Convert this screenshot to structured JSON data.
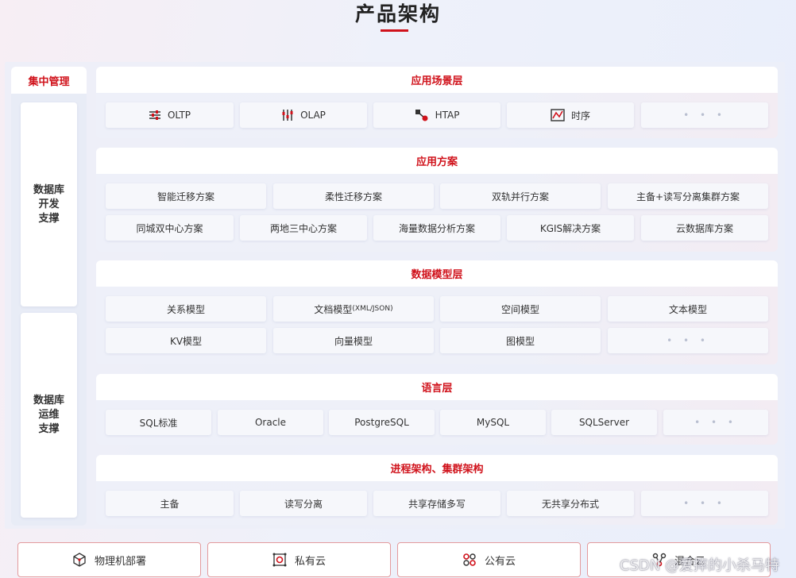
{
  "page": {
    "title": "产品架构",
    "accent_color": "#d0121b"
  },
  "left": {
    "header": "集中管理",
    "blocks": [
      [
        "数据库",
        "开发",
        "支撑"
      ],
      [
        "数据库",
        "运维",
        "支撑"
      ]
    ]
  },
  "sections": {
    "scenario": {
      "title": "应用场景层",
      "items": [
        {
          "label": "OLTP",
          "icon": "sliders-icon"
        },
        {
          "label": "OLAP",
          "icon": "equalizer-icon"
        },
        {
          "label": "HTAP",
          "icon": "hybrid-icon"
        },
        {
          "label": "时序",
          "icon": "timeseries-icon"
        },
        {
          "label": "• • •",
          "icon": ""
        }
      ]
    },
    "solutions": {
      "title": "应用方案",
      "row1": [
        "智能迁移方案",
        "柔性迁移方案",
        "双轨并行方案",
        "主备+读写分离集群方案"
      ],
      "row2": [
        "同城双中心方案",
        "两地三中心方案",
        "海量数据分析方案",
        "KGIS解决方案",
        "云数据库方案"
      ]
    },
    "datamodel": {
      "title": "数据模型层",
      "row1": [
        "关系模型",
        "文档模型",
        "(XML/JSON)",
        "空间模型",
        "文本模型"
      ],
      "row2": [
        "KV模型",
        "向量模型",
        "图模型",
        "• • •"
      ]
    },
    "language": {
      "title": "语言层",
      "items": [
        "SQL标准",
        "Oracle",
        "PostgreSQL",
        "MySQL",
        "SQLServer",
        "• • •"
      ]
    },
    "process": {
      "title": "进程架构、集群架构",
      "items": [
        "主备",
        "读写分离",
        "共享存储多写",
        "无共享分布式",
        "• • •"
      ]
    }
  },
  "deployment": [
    {
      "label": "物理机部署",
      "icon": "cube-icon"
    },
    {
      "label": "私有云",
      "icon": "private-cloud-icon"
    },
    {
      "label": "公有云",
      "icon": "public-cloud-icon"
    },
    {
      "label": "混合云",
      "icon": "hybrid-cloud-icon"
    }
  ],
  "watermark": "CSDN @爱摔的小杀马特"
}
